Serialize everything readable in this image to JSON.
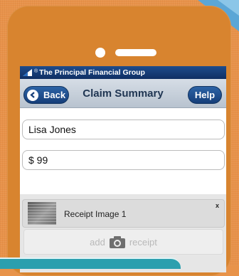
{
  "carrier": {
    "registered_mark": "®",
    "name": "The Principal Financial Group"
  },
  "nav": {
    "back_label": "Back",
    "title": "Claim Summary",
    "help_label": "Help"
  },
  "form": {
    "name_value": "Lisa Jones",
    "amount_value": "$ 99"
  },
  "receipts": {
    "items": [
      {
        "label": "Receipt Image 1",
        "remove_label": "x"
      }
    ],
    "add_word": "add",
    "receipt_word": "receipt"
  },
  "colors": {
    "background": "#e8924a",
    "phone_body": "#d8842f",
    "carrier_bar": "#16397a",
    "nav_button": "#1f4f8f",
    "accent_teal": "#2b9fae"
  }
}
